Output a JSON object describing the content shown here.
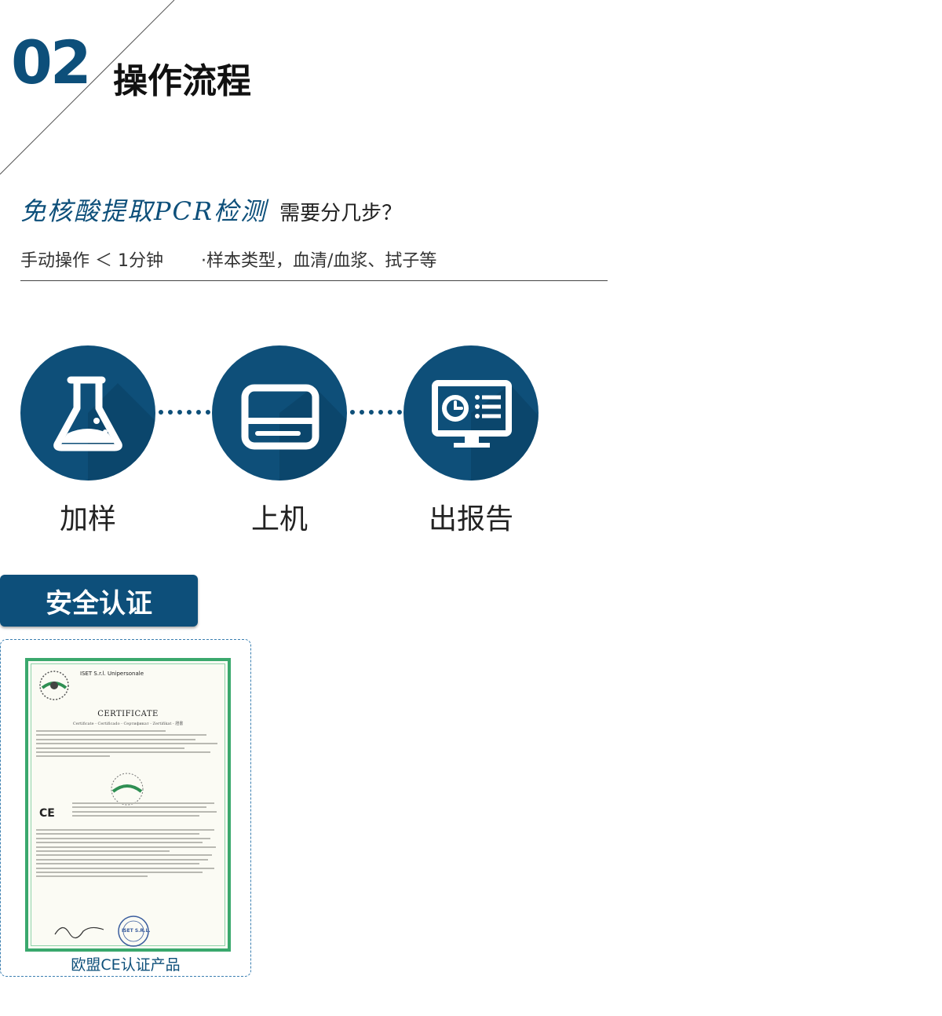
{
  "header": {
    "section_number": "02",
    "section_title": "操作流程"
  },
  "question": {
    "emphasis": "免核酸提取PCR检测",
    "tail": "需要分几步？"
  },
  "info": {
    "time_text": "手动操作 ＜ 1分钟",
    "sample_text": "·样本类型，血清/血浆、拭子等"
  },
  "steps": [
    {
      "label": "加样",
      "icon": "flask-icon"
    },
    {
      "label": "上机",
      "icon": "instrument-icon"
    },
    {
      "label": "出报告",
      "icon": "monitor-report-icon"
    }
  ],
  "certification": {
    "badge_label": "安全认证",
    "caption": "欧盟CE认证产品",
    "document": {
      "issuer": "ISET S.r.l. Unipersonale",
      "title": "CERTIFICATE",
      "subtitle": "Certificate - Certificado - Сертификат - Zertifikat - 證書",
      "stamp": "ISET S.R.L."
    }
  },
  "colors": {
    "brand_blue": "#0d4f7a",
    "circle_blue": "#0e4f79",
    "cert_green": "#3aa86d"
  }
}
